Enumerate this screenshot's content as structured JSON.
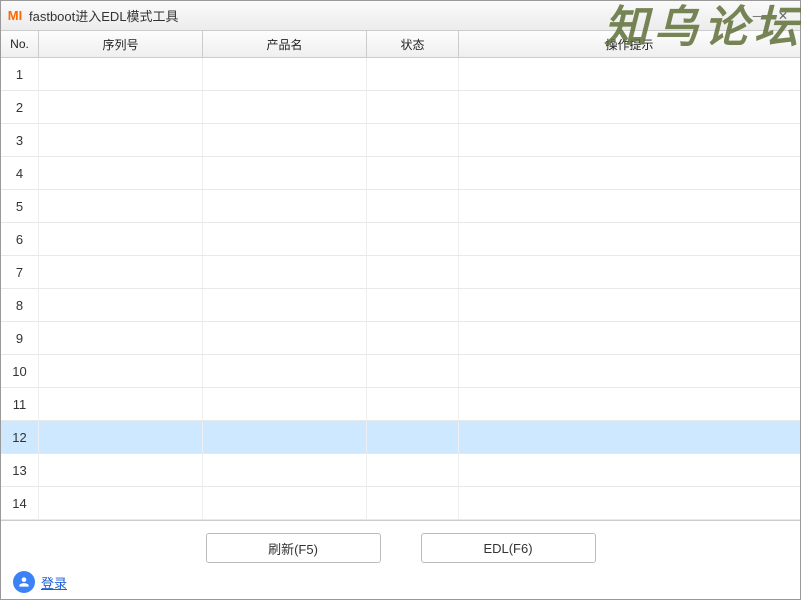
{
  "window": {
    "title": "fastboot进入EDL模式工具",
    "logo_text": "MI"
  },
  "columns": {
    "no": "No.",
    "serial": "序列号",
    "product": "产品名",
    "status": "状态",
    "tip": "操作提示"
  },
  "rows": [
    {
      "no": "1",
      "serial": "",
      "product": "",
      "status": "",
      "tip": ""
    },
    {
      "no": "2",
      "serial": "",
      "product": "",
      "status": "",
      "tip": ""
    },
    {
      "no": "3",
      "serial": "",
      "product": "",
      "status": "",
      "tip": ""
    },
    {
      "no": "4",
      "serial": "",
      "product": "",
      "status": "",
      "tip": ""
    },
    {
      "no": "5",
      "serial": "",
      "product": "",
      "status": "",
      "tip": ""
    },
    {
      "no": "6",
      "serial": "",
      "product": "",
      "status": "",
      "tip": ""
    },
    {
      "no": "7",
      "serial": "",
      "product": "",
      "status": "",
      "tip": ""
    },
    {
      "no": "8",
      "serial": "",
      "product": "",
      "status": "",
      "tip": ""
    },
    {
      "no": "9",
      "serial": "",
      "product": "",
      "status": "",
      "tip": ""
    },
    {
      "no": "10",
      "serial": "",
      "product": "",
      "status": "",
      "tip": ""
    },
    {
      "no": "11",
      "serial": "",
      "product": "",
      "status": "",
      "tip": ""
    },
    {
      "no": "12",
      "serial": "",
      "product": "",
      "status": "",
      "tip": ""
    },
    {
      "no": "13",
      "serial": "",
      "product": "",
      "status": "",
      "tip": ""
    },
    {
      "no": "14",
      "serial": "",
      "product": "",
      "status": "",
      "tip": ""
    }
  ],
  "selected_row_index": 11,
  "buttons": {
    "refresh": "刷新(F5)",
    "edl": "EDL(F6)"
  },
  "login": {
    "label": "登录"
  },
  "watermark": "知乌论坛"
}
